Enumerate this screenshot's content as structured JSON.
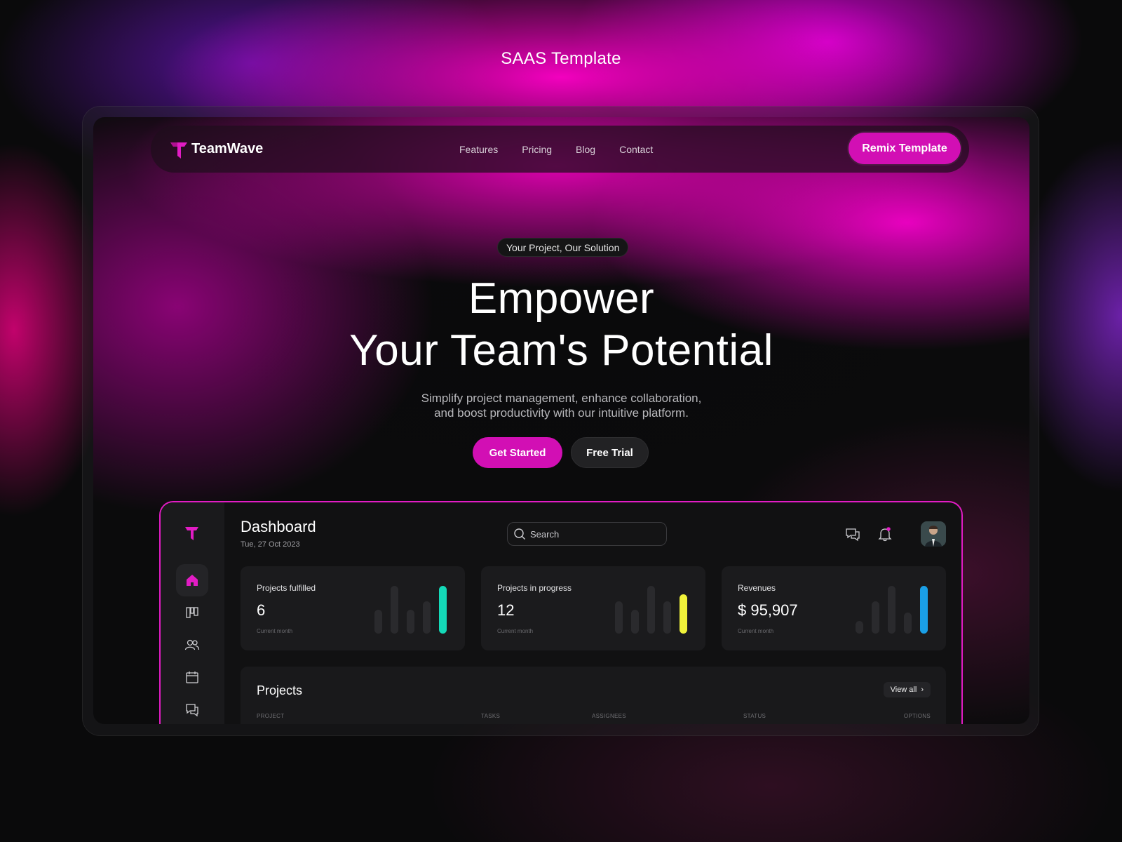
{
  "page": {
    "title": "SAAS Template"
  },
  "navbar": {
    "brand": "TeamWave",
    "links": [
      "Features",
      "Pricing",
      "Blog",
      "Contact"
    ],
    "cta": "Remix Template"
  },
  "hero": {
    "pill": "Your Project, Our Solution",
    "title_line1": "Empower",
    "title_line2": "Your Team's Potential",
    "subtitle_line1": "Simplify project management, enhance collaboration,",
    "subtitle_line2": "and boost productivity with our intuitive platform.",
    "primary_cta": "Get Started",
    "secondary_cta": "Free Trial"
  },
  "dashboard": {
    "title": "Dashboard",
    "date": "Tue, 27 Oct 2023",
    "search_placeholder": "Search",
    "sidebar_icons": [
      "home-icon",
      "board-icon",
      "team-icon",
      "calendar-icon",
      "chat-icon"
    ],
    "cards": [
      {
        "label": "Projects fulfilled",
        "value": "6",
        "sub": "Current month",
        "accent": "#14d9b8"
      },
      {
        "label": "Projects in progress",
        "value": "12",
        "sub": "Current month",
        "accent": "#f0f23a"
      },
      {
        "label": "Revenues",
        "value": "$ 95,907",
        "sub": "Current month",
        "accent": "#1a9fe6"
      }
    ],
    "projects": {
      "title": "Projects",
      "view_all": "View all",
      "columns": [
        "PROJECT",
        "TASKS",
        "ASSIGNEES",
        "STATUS",
        "OPTIONS"
      ]
    }
  },
  "colors": {
    "accent": "#d20fb4",
    "border": "#e21cc4"
  }
}
